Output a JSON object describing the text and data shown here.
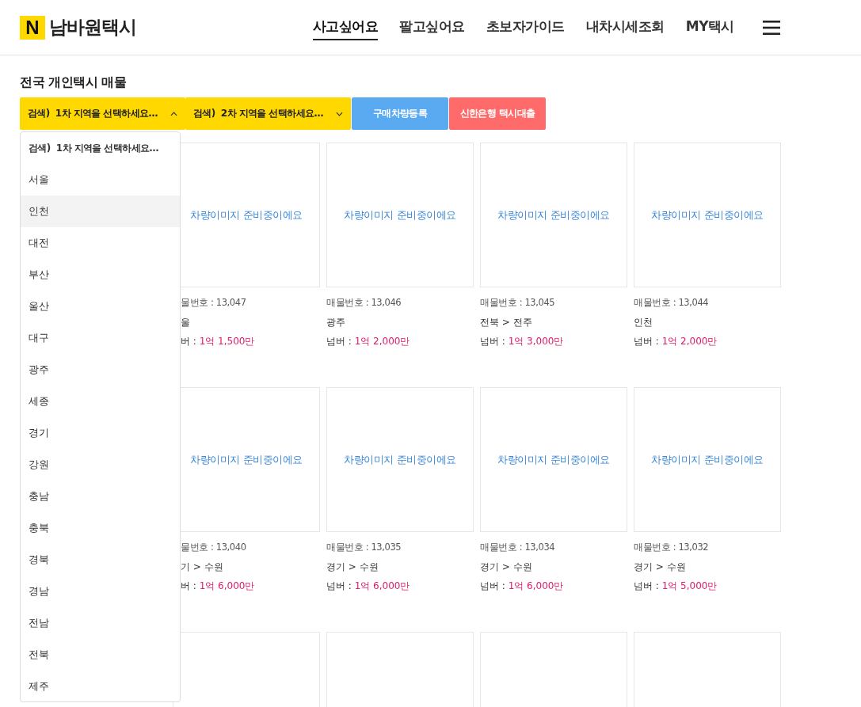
{
  "header": {
    "logo_mark": "N",
    "logo_text": "남바원택시",
    "nav": [
      {
        "label": "사고싶어요",
        "selected": true
      },
      {
        "label": "팔고싶어요",
        "selected": false
      },
      {
        "label": "초보자가이드",
        "selected": false
      },
      {
        "label": "내차시세조회",
        "selected": false
      },
      {
        "label": "MY택시",
        "selected": false
      }
    ]
  },
  "page_title": "전국 개인택시 매물",
  "filters": [
    {
      "kind": "select",
      "value": "검색)  1차 지역을 선택하세요...",
      "expanded": true
    },
    {
      "kind": "select",
      "value": "검색)  2차 지역을 선택하세요...",
      "expanded": false
    },
    {
      "kind": "button",
      "label": "구매차량등록",
      "color": "#5aaaf2"
    },
    {
      "kind": "button",
      "label": "신한은행 택시대출",
      "color": "#ff6b6b"
    }
  ],
  "dropdown": {
    "items": [
      {
        "label": "검색)  1차 지역을 선택하세요...",
        "kind": "placeholder",
        "selected": false
      },
      {
        "label": "서울",
        "kind": "option",
        "selected": false
      },
      {
        "label": "인천",
        "kind": "option",
        "selected": true
      },
      {
        "label": "대전",
        "kind": "option",
        "selected": false
      },
      {
        "label": "부산",
        "kind": "option",
        "selected": false
      },
      {
        "label": "울산",
        "kind": "option",
        "selected": false
      },
      {
        "label": "대구",
        "kind": "option",
        "selected": false
      },
      {
        "label": "광주",
        "kind": "option",
        "selected": false
      },
      {
        "label": "세종",
        "kind": "option",
        "selected": false
      },
      {
        "label": "경기",
        "kind": "option",
        "selected": false
      },
      {
        "label": "강원",
        "kind": "option",
        "selected": false
      },
      {
        "label": "충남",
        "kind": "option",
        "selected": false
      },
      {
        "label": "충북",
        "kind": "option",
        "selected": false
      },
      {
        "label": "경북",
        "kind": "option",
        "selected": false
      },
      {
        "label": "경남",
        "kind": "option",
        "selected": false
      },
      {
        "label": "전남",
        "kind": "option",
        "selected": false
      },
      {
        "label": "전북",
        "kind": "option",
        "selected": false
      },
      {
        "label": "제주",
        "kind": "option",
        "selected": false
      }
    ]
  },
  "listing_rows": [
    [
      {
        "kind": "full",
        "image_text": "차량이미지 준비중이에요",
        "number": "물번호 : 13,047",
        "region": "울",
        "price_label": "버 :",
        "price": "1억 1,500만"
      },
      {
        "kind": "full",
        "image_text": "차량이미지 준비중이에요",
        "number": "매물번호 : 13,046",
        "region": "광주",
        "price_label": "넘버 :",
        "price": "1억 2,000만"
      },
      {
        "kind": "full",
        "image_text": "차량이미지 준비중이에요",
        "number": "매물번호 : 13,045",
        "region": "전북 > 전주",
        "price_label": "넘버 :",
        "price": "1억 3,000만"
      },
      {
        "kind": "full",
        "image_text": "차량이미지 준비중이에요",
        "number": "매물번호 : 13,044",
        "region": "인천",
        "price_label": "넘버 :",
        "price": "1억 2,000만"
      }
    ],
    [
      {
        "kind": "full",
        "image_text": "차량이미지 준비중이에요",
        "number": "물번호 : 13,040",
        "region": "기 > 수원",
        "price_label": "버 :",
        "price": "1억 6,000만"
      },
      {
        "kind": "full",
        "image_text": "차량이미지 준비중이에요",
        "number": "매물번호 : 13,035",
        "region": "경기 > 수원",
        "price_label": "넘버 :",
        "price": "1억 6,000만"
      },
      {
        "kind": "full",
        "image_text": "차량이미지 준비중이에요",
        "number": "매물번호 : 13,034",
        "region": "경기 > 수원",
        "price_label": "넘버 :",
        "price": "1억 6,000만"
      },
      {
        "kind": "full",
        "image_text": "차량이미지 준비중이에요",
        "number": "매물번호 : 13,032",
        "region": "경기 > 수원",
        "price_label": "넘버 :",
        "price": "1억 5,000만"
      }
    ],
    [
      {
        "kind": "image-only"
      },
      {
        "kind": "image-only"
      },
      {
        "kind": "image-only"
      },
      {
        "kind": "image-only"
      }
    ]
  ]
}
